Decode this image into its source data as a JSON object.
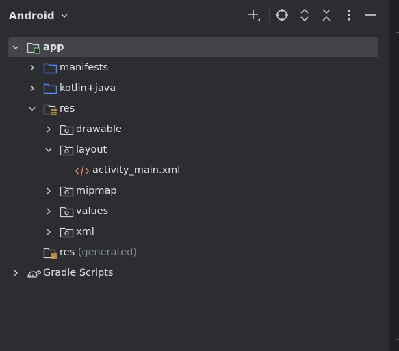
{
  "header": {
    "view_label": "Android",
    "toolbar_icons": [
      "add-icon",
      "locate-icon",
      "expand-all-icon",
      "collapse-all-icon",
      "more-options-icon",
      "hide-icon"
    ]
  },
  "tree": {
    "app": {
      "label": "app"
    },
    "manifests": {
      "label": "manifests"
    },
    "kotlin_java": {
      "label": "kotlin+java"
    },
    "res": {
      "label": "res"
    },
    "drawable": {
      "label": "drawable"
    },
    "layout": {
      "label": "layout"
    },
    "activity_main": {
      "label": "activity_main.xml"
    },
    "mipmap": {
      "label": "mipmap"
    },
    "values": {
      "label": "values"
    },
    "xml": {
      "label": "xml"
    },
    "res_generated": {
      "label": "res",
      "suffix": "(generated)"
    },
    "gradle_scripts": {
      "label": "Gradle Scripts"
    }
  },
  "colors": {
    "background": "#2b2d30",
    "selection": "#43454a",
    "text": "#dfe1e5",
    "dim_text": "#868a91",
    "folder_blue": "#548af7",
    "module_green": "#5fb865",
    "xml_orange": "#e08855",
    "resource_yellow": "#d9a343"
  }
}
